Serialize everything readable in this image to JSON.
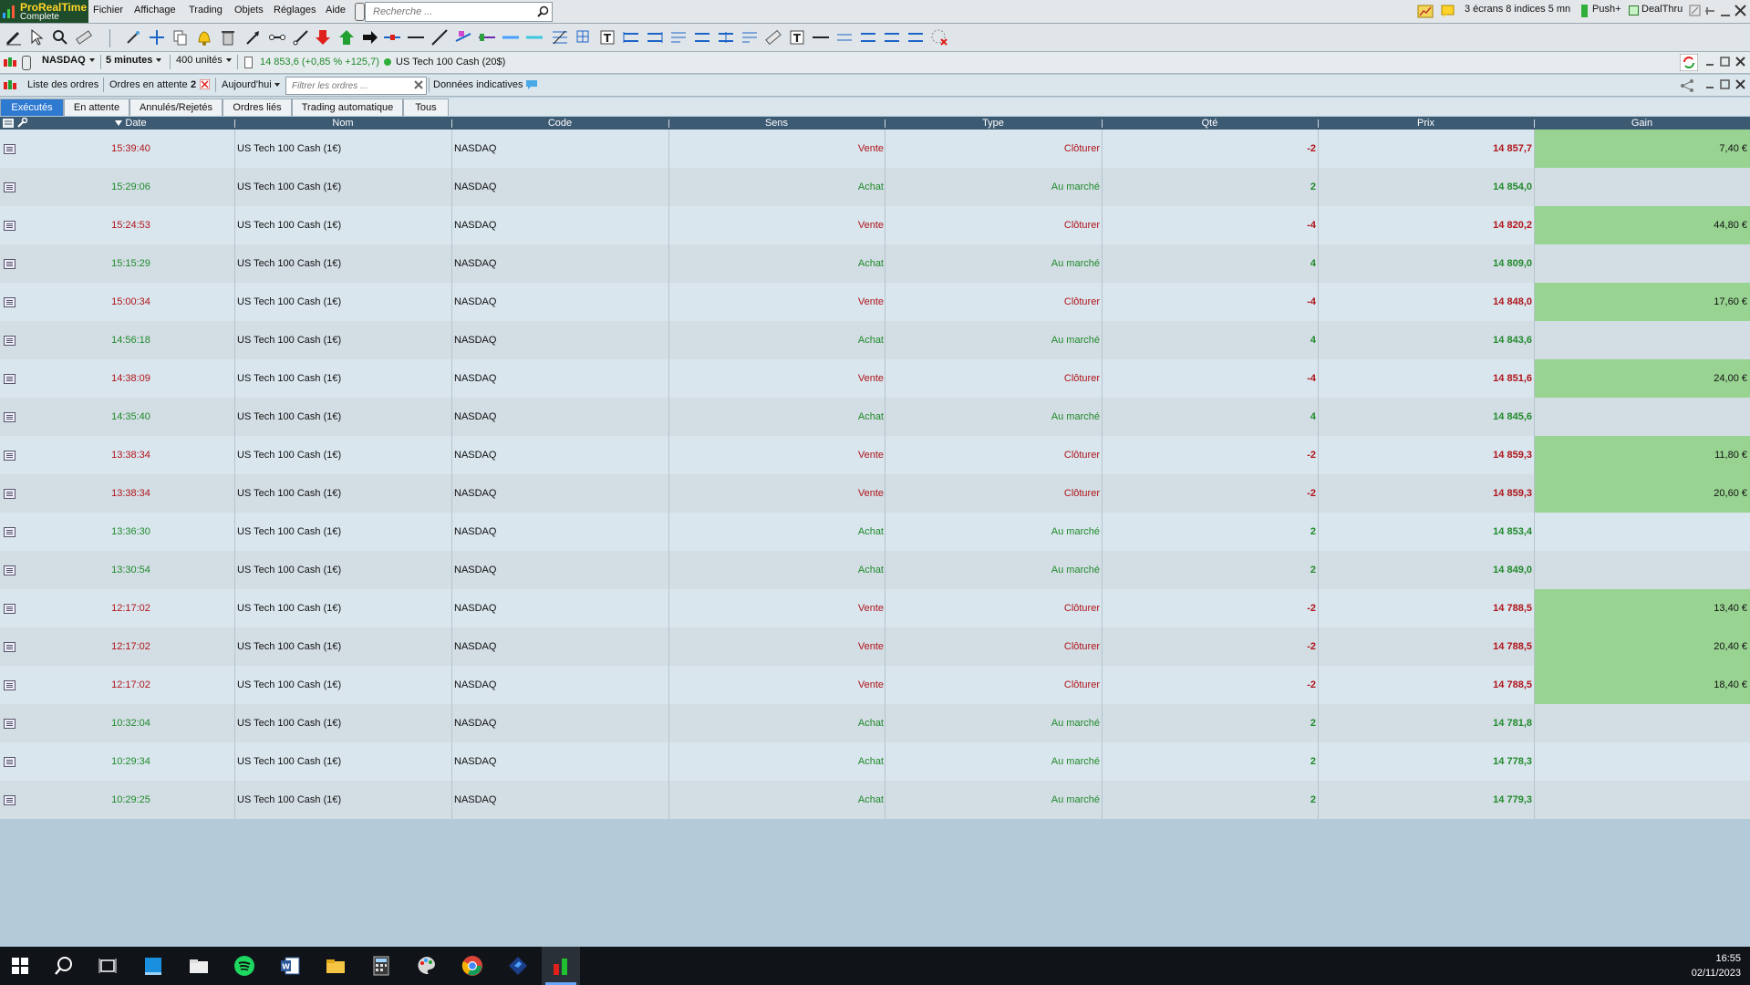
{
  "app": {
    "name": "ProRealTime",
    "edition": "Complete"
  },
  "menu": [
    "Fichier",
    "Affichage",
    "Trading",
    "Objets",
    "Réglages",
    "Aide"
  ],
  "search": {
    "placeholder": "Recherche ..."
  },
  "topright": {
    "screens": "3 écrans 8 indices 5 mn",
    "push": "Push+",
    "dealthru": "DealThru"
  },
  "instrument": {
    "market": "NASDAQ",
    "interval": "5 minutes",
    "units": "400 unités",
    "quote": "14 853,6 (+0,85 % +125,7)",
    "name": "US Tech 100 Cash (20$)"
  },
  "orders_bar": {
    "list_label": "Liste des ordres",
    "pending_label": "Ordres en attente",
    "pending_count": "2",
    "period": "Aujourd'hui",
    "filter_placeholder": "Filtrer les ordres ...",
    "data_label": "Données indicatives"
  },
  "tabs": [
    "Exécutés",
    "En attente",
    "Annulés/Rejetés",
    "Ordres liés",
    "Trading automatique",
    "Tous"
  ],
  "active_tab": "Exécutés",
  "columns": [
    "Date",
    "Nom",
    "Code",
    "Sens",
    "Type",
    "Qté",
    "Prix",
    "Gain"
  ],
  "rows": [
    {
      "date": "15:39:40",
      "nom": "US Tech 100 Cash (1€)",
      "code": "NASDAQ",
      "sens": "Vente",
      "type": "Clôturer",
      "qte": "-2",
      "prix": "14 857,7",
      "gain": "7,40 €"
    },
    {
      "date": "15:29:06",
      "nom": "US Tech 100 Cash (1€)",
      "code": "NASDAQ",
      "sens": "Achat",
      "type": "Au marché",
      "qte": "2",
      "prix": "14 854,0",
      "gain": ""
    },
    {
      "date": "15:24:53",
      "nom": "US Tech 100 Cash (1€)",
      "code": "NASDAQ",
      "sens": "Vente",
      "type": "Clôturer",
      "qte": "-4",
      "prix": "14 820,2",
      "gain": "44,80 €"
    },
    {
      "date": "15:15:29",
      "nom": "US Tech 100 Cash (1€)",
      "code": "NASDAQ",
      "sens": "Achat",
      "type": "Au marché",
      "qte": "4",
      "prix": "14 809,0",
      "gain": ""
    },
    {
      "date": "15:00:34",
      "nom": "US Tech 100 Cash (1€)",
      "code": "NASDAQ",
      "sens": "Vente",
      "type": "Clôturer",
      "qte": "-4",
      "prix": "14 848,0",
      "gain": "17,60 €"
    },
    {
      "date": "14:56:18",
      "nom": "US Tech 100 Cash (1€)",
      "code": "NASDAQ",
      "sens": "Achat",
      "type": "Au marché",
      "qte": "4",
      "prix": "14 843,6",
      "gain": ""
    },
    {
      "date": "14:38:09",
      "nom": "US Tech 100 Cash (1€)",
      "code": "NASDAQ",
      "sens": "Vente",
      "type": "Clôturer",
      "qte": "-4",
      "prix": "14 851,6",
      "gain": "24,00 €"
    },
    {
      "date": "14:35:40",
      "nom": "US Tech 100 Cash (1€)",
      "code": "NASDAQ",
      "sens": "Achat",
      "type": "Au marché",
      "qte": "4",
      "prix": "14 845,6",
      "gain": ""
    },
    {
      "date": "13:38:34",
      "nom": "US Tech 100 Cash (1€)",
      "code": "NASDAQ",
      "sens": "Vente",
      "type": "Clôturer",
      "qte": "-2",
      "prix": "14 859,3",
      "gain": "11,80 €"
    },
    {
      "date": "13:38:34",
      "nom": "US Tech 100 Cash (1€)",
      "code": "NASDAQ",
      "sens": "Vente",
      "type": "Clôturer",
      "qte": "-2",
      "prix": "14 859,3",
      "gain": "20,60 €"
    },
    {
      "date": "13:36:30",
      "nom": "US Tech 100 Cash (1€)",
      "code": "NASDAQ",
      "sens": "Achat",
      "type": "Au marché",
      "qte": "2",
      "prix": "14 853,4",
      "gain": ""
    },
    {
      "date": "13:30:54",
      "nom": "US Tech 100 Cash (1€)",
      "code": "NASDAQ",
      "sens": "Achat",
      "type": "Au marché",
      "qte": "2",
      "prix": "14 849,0",
      "gain": ""
    },
    {
      "date": "12:17:02",
      "nom": "US Tech 100 Cash (1€)",
      "code": "NASDAQ",
      "sens": "Vente",
      "type": "Clôturer",
      "qte": "-2",
      "prix": "14 788,5",
      "gain": "13,40 €"
    },
    {
      "date": "12:17:02",
      "nom": "US Tech 100 Cash (1€)",
      "code": "NASDAQ",
      "sens": "Vente",
      "type": "Clôturer",
      "qte": "-2",
      "prix": "14 788,5",
      "gain": "20,40 €"
    },
    {
      "date": "12:17:02",
      "nom": "US Tech 100 Cash (1€)",
      "code": "NASDAQ",
      "sens": "Vente",
      "type": "Clôturer",
      "qte": "-2",
      "prix": "14 788,5",
      "gain": "18,40 €"
    },
    {
      "date": "10:32:04",
      "nom": "US Tech 100 Cash (1€)",
      "code": "NASDAQ",
      "sens": "Achat",
      "type": "Au marché",
      "qte": "2",
      "prix": "14 781,8",
      "gain": ""
    },
    {
      "date": "10:29:34",
      "nom": "US Tech 100 Cash (1€)",
      "code": "NASDAQ",
      "sens": "Achat",
      "type": "Au marché",
      "qte": "2",
      "prix": "14 778,3",
      "gain": ""
    },
    {
      "date": "10:29:25",
      "nom": "US Tech 100 Cash (1€)",
      "code": "NASDAQ",
      "sens": "Achat",
      "type": "Au marché",
      "qte": "2",
      "prix": "14 779,3",
      "gain": ""
    }
  ],
  "colors": {
    "buy": "#1f8a2a",
    "sell": "#b0141a",
    "gain_bg": "#98d391",
    "header_bg": "#3d5a73",
    "active_tab": "#2f7ad1"
  },
  "taskbar": {
    "icons": [
      "windows-start-icon",
      "search-icon",
      "task-view-icon",
      "app-blue-icon",
      "file-folder-icon",
      "spotify-icon",
      "word-icon",
      "file-explorer-icon",
      "calculator-icon",
      "paint-icon",
      "chrome-icon",
      "prorealtime-blue-icon",
      "prorealtime-icon"
    ],
    "time": "16:55",
    "date": "02/11/2023"
  }
}
